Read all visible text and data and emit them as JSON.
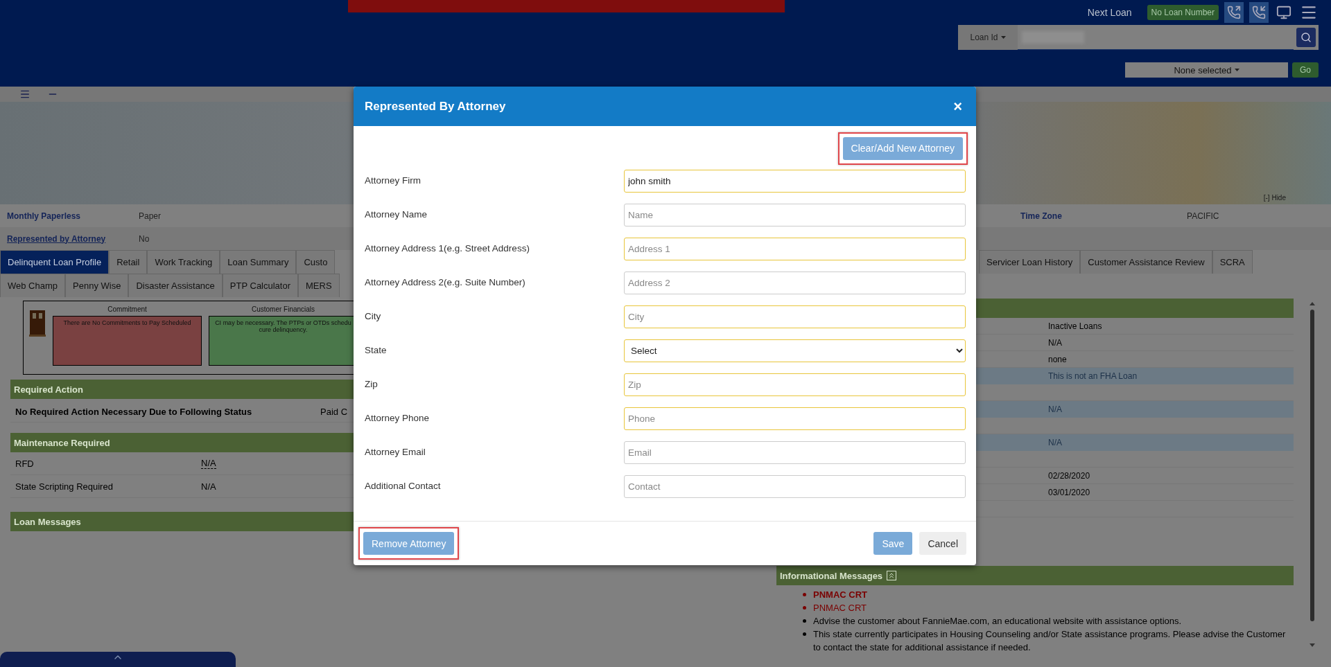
{
  "header": {
    "next_loan_label": "Next Loan",
    "loan_number_button": "No Loan Number",
    "search_type": "Loan Id",
    "filter": "None selected",
    "go_button": "Go"
  },
  "customer_rows": [
    {
      "label": "Monthly Paperless",
      "value": "Paper",
      "link": false
    },
    {
      "label": "Represented by Attorney",
      "value": "No",
      "link": true
    }
  ],
  "time_zone": {
    "label": "Time Zone",
    "value": "PACIFIC"
  },
  "hide_toggle": "[-] Hide",
  "tabs_row_1_left": [
    {
      "label": "Delinquent Loan Profile",
      "selected": true
    },
    {
      "label": "Retail",
      "selected": false
    },
    {
      "label": "Work Tracking",
      "selected": false
    },
    {
      "label": "Loan Summary",
      "selected": false
    },
    {
      "label": "Custo",
      "selected": false
    }
  ],
  "tabs_row_1_right": [
    {
      "label": "Servicer Loan History",
      "selected": false
    },
    {
      "label": "Customer Assistance Review",
      "selected": false
    },
    {
      "label": "SCRA",
      "selected": false
    }
  ],
  "tabs_row_2": [
    {
      "label": "Web Champ",
      "selected": false
    },
    {
      "label": "Penny Wise",
      "selected": false
    },
    {
      "label": "Disaster Assistance",
      "selected": false
    },
    {
      "label": "PTP Calculator",
      "selected": false
    },
    {
      "label": "MERS",
      "selected": false
    }
  ],
  "status_panel": [
    {
      "title": "Commitment",
      "lines": [
        "There are No Commitments to Pay Scheduled"
      ],
      "color": "#7a4141"
    },
    {
      "title": "Customer Financials",
      "lines": [
        "CI may be necessary. The PTPs or OTDs schedu",
        "cure delinquency."
      ],
      "color": "#4a774a"
    }
  ],
  "required_action": {
    "title": "Required Action",
    "message": "No Required Action Necessary Due to Following Status",
    "status": "Paid C"
  },
  "maintenance_required": {
    "title": "Maintenance Required",
    "rows": [
      {
        "label": "RFD",
        "value": "N/A",
        "underlined": true
      },
      {
        "label": "State Scripting Required",
        "value": "N/A",
        "underlined": false
      }
    ]
  },
  "loan_messages": {
    "title": "Loan Messages"
  },
  "right_rows": [
    {
      "value": "Inactive Loans",
      "highlighted": false
    },
    {
      "value": "N/A",
      "highlighted": false
    },
    {
      "value": "none",
      "highlighted": false
    },
    {
      "value": "This is not an FHA Loan",
      "highlighted": true
    },
    {
      "highlighted": false
    },
    {
      "value": "N/A",
      "highlighted": true
    },
    {
      "highlighted": false
    },
    {
      "value": "N/A",
      "highlighted": true
    },
    {
      "highlighted": false
    },
    {
      "value": "02/28/2020",
      "highlighted": false
    },
    {
      "value": "03/01/2020",
      "highlighted": false
    },
    {
      "highlighted": false
    }
  ],
  "informational_messages": {
    "title": "Informational Messages",
    "items": [
      {
        "text": "PNMAC CRT",
        "bold": true,
        "color": "#7a0000"
      },
      {
        "text": "PNMAC CRT",
        "bold": false,
        "color": "#7a0000"
      },
      {
        "text": "Advise the customer about FannieMae.com, an educational website with assistance options.",
        "bold": false,
        "color": "#000000"
      },
      {
        "text": "This state currently participates in Housing Counseling and/or State assistance programs. Please advise the Customer to contact the state for additional assistance if needed.",
        "bold": false,
        "color": "#000000"
      }
    ]
  },
  "modal": {
    "title": "Represented By Attorney",
    "close": "×",
    "clear_button": {
      "label": "Clear/Add New Attorney",
      "highlighted": true
    },
    "fields": [
      {
        "kind": "text",
        "label": "Attorney Firm",
        "value": "john smith",
        "required": true
      },
      {
        "kind": "text",
        "label": "Attorney Name",
        "placeholder": "Name",
        "required": false
      },
      {
        "kind": "text",
        "label": "Attorney Address 1(e.g. Street Address)",
        "placeholder": "Address 1",
        "required": true
      },
      {
        "kind": "text",
        "label": "Attorney Address 2(e.g. Suite Number)",
        "placeholder": "Address 2",
        "required": false
      },
      {
        "kind": "text",
        "label": "City",
        "placeholder": "City",
        "required": true
      },
      {
        "kind": "select",
        "label": "State",
        "value": "Select",
        "required": true
      },
      {
        "kind": "text",
        "label": "Zip",
        "placeholder": "Zip",
        "required": true
      },
      {
        "kind": "text",
        "label": "Attorney Phone",
        "placeholder": "Phone",
        "required": true
      },
      {
        "kind": "text",
        "label": "Attorney Email",
        "placeholder": "Email",
        "required": false
      },
      {
        "kind": "text",
        "label": "Additional Contact",
        "placeholder": "Contact",
        "required": false
      }
    ],
    "remove_button": {
      "label": "Remove Attorney",
      "highlighted": true
    },
    "save_button": "Save",
    "cancel_button": "Cancel"
  }
}
